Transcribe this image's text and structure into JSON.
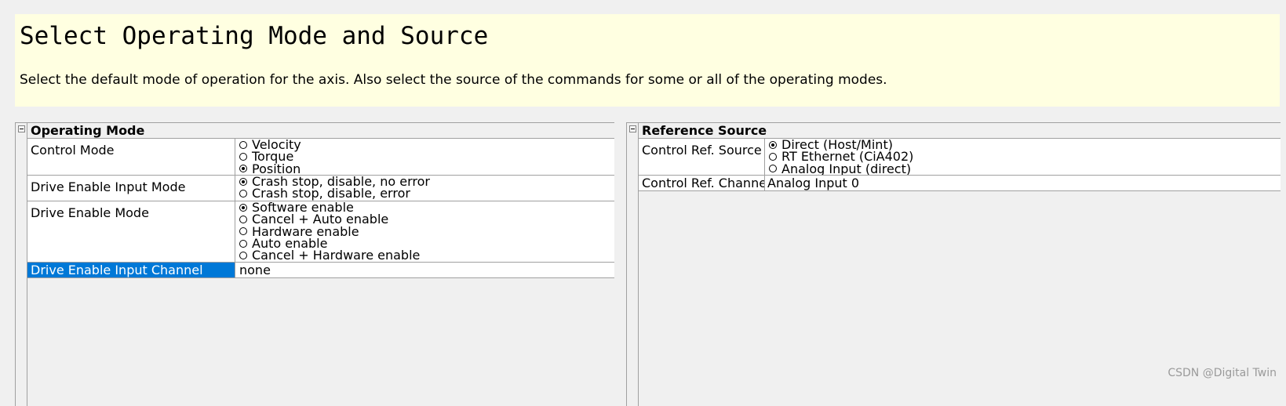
{
  "header": {
    "title": "Select Operating Mode and Source",
    "description": "Select the default mode of operation for the axis. Also select the source of the commands for some or all of the operating modes."
  },
  "operating_mode": {
    "title": "Operating Mode",
    "rows": [
      {
        "label": "Control Mode",
        "options": [
          "Velocity",
          "Torque",
          "Position"
        ],
        "selected": 2
      },
      {
        "label": "Drive Enable Input Mode",
        "options": [
          "Crash stop, disable, no error",
          "Crash stop, disable, error"
        ],
        "selected": 0
      },
      {
        "label": "Drive Enable Mode",
        "options": [
          "Software enable",
          "Cancel + Auto enable",
          "Hardware enable",
          "Auto enable",
          "Cancel + Hardware enable"
        ],
        "selected": 0
      },
      {
        "label": "Drive Enable Input Channel",
        "value": "none"
      }
    ]
  },
  "reference_source": {
    "title": "Reference Source",
    "rows": [
      {
        "label": "Control Ref. Source",
        "options": [
          "Direct (Host/Mint)",
          "RT Ethernet (CiA402)",
          "Analog Input (direct)"
        ],
        "selected": 0
      },
      {
        "label": "Control Ref. Channel",
        "value": "Analog Input 0"
      }
    ]
  },
  "watermark": "CSDN @Digital Twin",
  "icons": {
    "collapse": "collapse-icon",
    "radio": "radio-button-icon"
  },
  "colors": {
    "header_bg": "#ffffe1",
    "selection": "#0078d7",
    "background": "#f0f0f0"
  }
}
